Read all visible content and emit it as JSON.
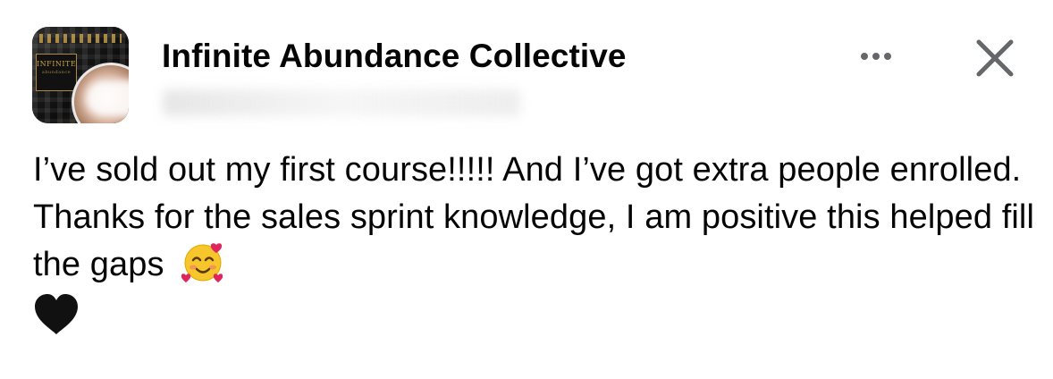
{
  "post": {
    "group_name": "Infinite Abundance Collective",
    "avatar_icon": "group-avatar",
    "menu_icon": "more-icon",
    "close_icon": "close-icon",
    "avatar_lettering": [
      "INFINITE",
      "abundance"
    ],
    "body_text": "I’ve sold out my first course!!!!! And I’ve got extra people enrolled. Thanks for the sales sprint knowledge, I am positive this helped fill the gaps",
    "emojis": [
      "smiling-face-with-hearts",
      "black-heart"
    ]
  },
  "colors": {
    "text": "#050505",
    "icon_gray": "#65676b",
    "heart": "#111111",
    "emoji_face": "#f7c52c",
    "emoji_hearts": "#e0245e"
  }
}
